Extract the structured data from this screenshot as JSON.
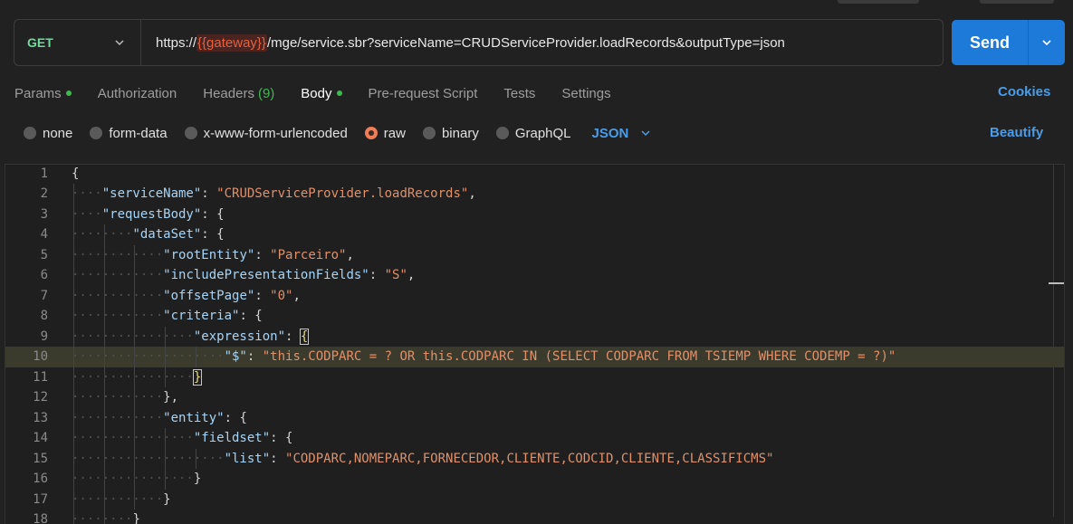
{
  "request": {
    "method": "GET",
    "url_prefix": "https://",
    "url_variable": "{{gateway}}",
    "url_suffix": "/mge/service.sbr?serviceName=CRUDServiceProvider.loadRecords&outputType=json",
    "send_label": "Send"
  },
  "tabs": [
    {
      "label": "Params",
      "dot": true
    },
    {
      "label": "Authorization"
    },
    {
      "label": "Headers",
      "count": "(9)"
    },
    {
      "label": "Body",
      "dot": true,
      "active": true
    },
    {
      "label": "Pre-request Script"
    },
    {
      "label": "Tests"
    },
    {
      "label": "Settings"
    }
  ],
  "cookies_label": "Cookies",
  "body_types": [
    {
      "label": "none"
    },
    {
      "label": "form-data"
    },
    {
      "label": "x-www-form-urlencoded"
    },
    {
      "label": "raw",
      "selected": true
    },
    {
      "label": "binary"
    },
    {
      "label": "GraphQL"
    }
  ],
  "language": "JSON",
  "beautify_label": "Beautify",
  "colors": {
    "method_get": "#6bdd9a",
    "accent_blue": "#1e7ad8",
    "link_blue": "#4a9dea",
    "active_dot": "#3fb950",
    "radio_selected": "#ef7e56"
  },
  "editor": {
    "lines": [
      {
        "n": "1",
        "indent": 0,
        "tokens": [
          [
            "p",
            "{"
          ]
        ]
      },
      {
        "n": "2",
        "indent": 1,
        "tokens": [
          [
            "k",
            "\"serviceName\""
          ],
          [
            "p",
            ": "
          ],
          [
            "s",
            "\"CRUDServiceProvider.loadRecords\""
          ],
          [
            "p",
            ","
          ]
        ]
      },
      {
        "n": "3",
        "indent": 1,
        "tokens": [
          [
            "k",
            "\"requestBody\""
          ],
          [
            "p",
            ": {"
          ]
        ]
      },
      {
        "n": "4",
        "indent": 2,
        "tokens": [
          [
            "k",
            "\"dataSet\""
          ],
          [
            "p",
            ": {"
          ]
        ]
      },
      {
        "n": "5",
        "indent": 3,
        "tokens": [
          [
            "k",
            "\"rootEntity\""
          ],
          [
            "p",
            ": "
          ],
          [
            "s",
            "\"Parceiro\""
          ],
          [
            "p",
            ","
          ]
        ]
      },
      {
        "n": "6",
        "indent": 3,
        "tokens": [
          [
            "k",
            "\"includePresentationFields\""
          ],
          [
            "p",
            ": "
          ],
          [
            "s",
            "\"S\""
          ],
          [
            "p",
            ","
          ]
        ]
      },
      {
        "n": "7",
        "indent": 3,
        "tokens": [
          [
            "k",
            "\"offsetPage\""
          ],
          [
            "p",
            ": "
          ],
          [
            "s",
            "\"0\""
          ],
          [
            "p",
            ","
          ]
        ]
      },
      {
        "n": "8",
        "indent": 3,
        "tokens": [
          [
            "k",
            "\"criteria\""
          ],
          [
            "p",
            ": {"
          ]
        ]
      },
      {
        "n": "9",
        "indent": 4,
        "tokens": [
          [
            "k",
            "\"expression\""
          ],
          [
            "p",
            ": "
          ],
          [
            "br",
            "{"
          ]
        ]
      },
      {
        "n": "10",
        "indent": 5,
        "tokens": [
          [
            "k",
            "\"$\""
          ],
          [
            "p",
            ": "
          ],
          [
            "s",
            "\"this.CODPARC = ? OR this.CODPARC IN (SELECT CODPARC FROM TSIEMP WHERE CODEMP = ?)\""
          ]
        ],
        "highlight": true
      },
      {
        "n": "11",
        "indent": 4,
        "tokens": [
          [
            "br",
            "}"
          ]
        ]
      },
      {
        "n": "12",
        "indent": 3,
        "tokens": [
          [
            "p",
            "},"
          ]
        ]
      },
      {
        "n": "13",
        "indent": 3,
        "tokens": [
          [
            "k",
            "\"entity\""
          ],
          [
            "p",
            ": {"
          ]
        ]
      },
      {
        "n": "14",
        "indent": 4,
        "tokens": [
          [
            "k",
            "\"fieldset\""
          ],
          [
            "p",
            ": {"
          ]
        ]
      },
      {
        "n": "15",
        "indent": 5,
        "tokens": [
          [
            "k",
            "\"list\""
          ],
          [
            "p",
            ": "
          ],
          [
            "s",
            "\"CODPARC,NOMEPARC,FORNECEDOR,CLIENTE,CODCID,CLIENTE,CLASSIFICMS\""
          ]
        ]
      },
      {
        "n": "16",
        "indent": 4,
        "tokens": [
          [
            "p",
            "}"
          ]
        ]
      },
      {
        "n": "17",
        "indent": 3,
        "tokens": [
          [
            "p",
            "}"
          ]
        ]
      },
      {
        "n": "18",
        "indent": 2,
        "tokens": [
          [
            "p",
            "}"
          ]
        ]
      }
    ]
  }
}
